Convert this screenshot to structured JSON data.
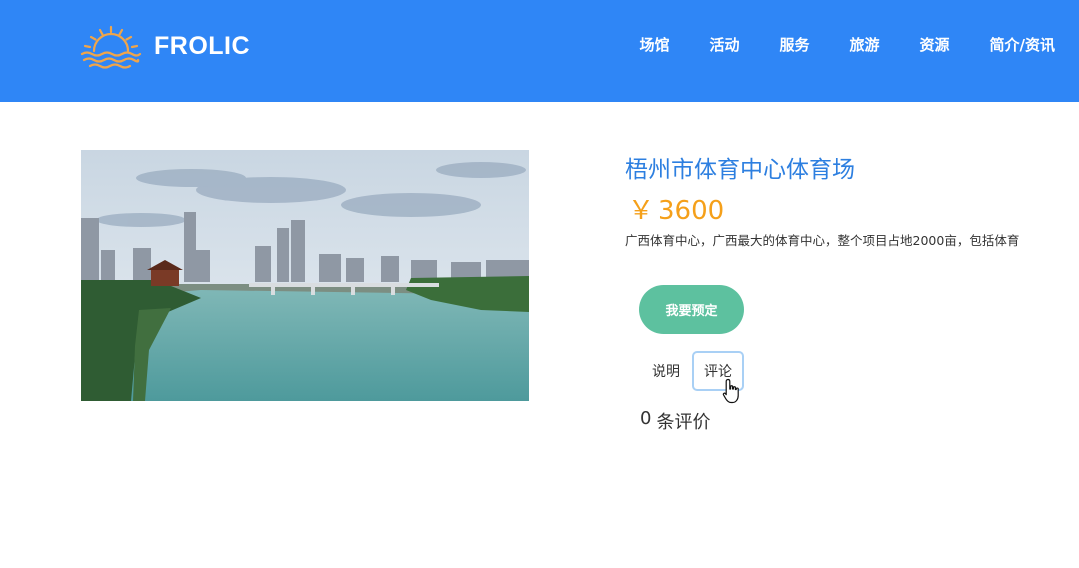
{
  "header": {
    "brand_name": "FROLIC",
    "logo_icon": "sunset-icon",
    "bg_color": "#2f86f6",
    "nav": [
      {
        "label": "场馆"
      },
      {
        "label": "活动"
      },
      {
        "label": "服务"
      },
      {
        "label": "旅游"
      },
      {
        "label": "资源"
      },
      {
        "label": "简介/资讯"
      }
    ]
  },
  "product": {
    "title": "梧州市体育中心体育场",
    "currency": "￥",
    "price": "3600",
    "description": "广西体育中心，广西最大的体育中心，整个项目占地2000亩，包括体育",
    "book_button": "我要预定",
    "tabs": [
      {
        "label": "说明",
        "active": false
      },
      {
        "label": "评论",
        "active": true
      }
    ],
    "review_count": "0",
    "review_unit": "条评价",
    "title_color": "#2d7fe0",
    "price_color": "#f5a01a",
    "button_color": "#5dc19f"
  }
}
